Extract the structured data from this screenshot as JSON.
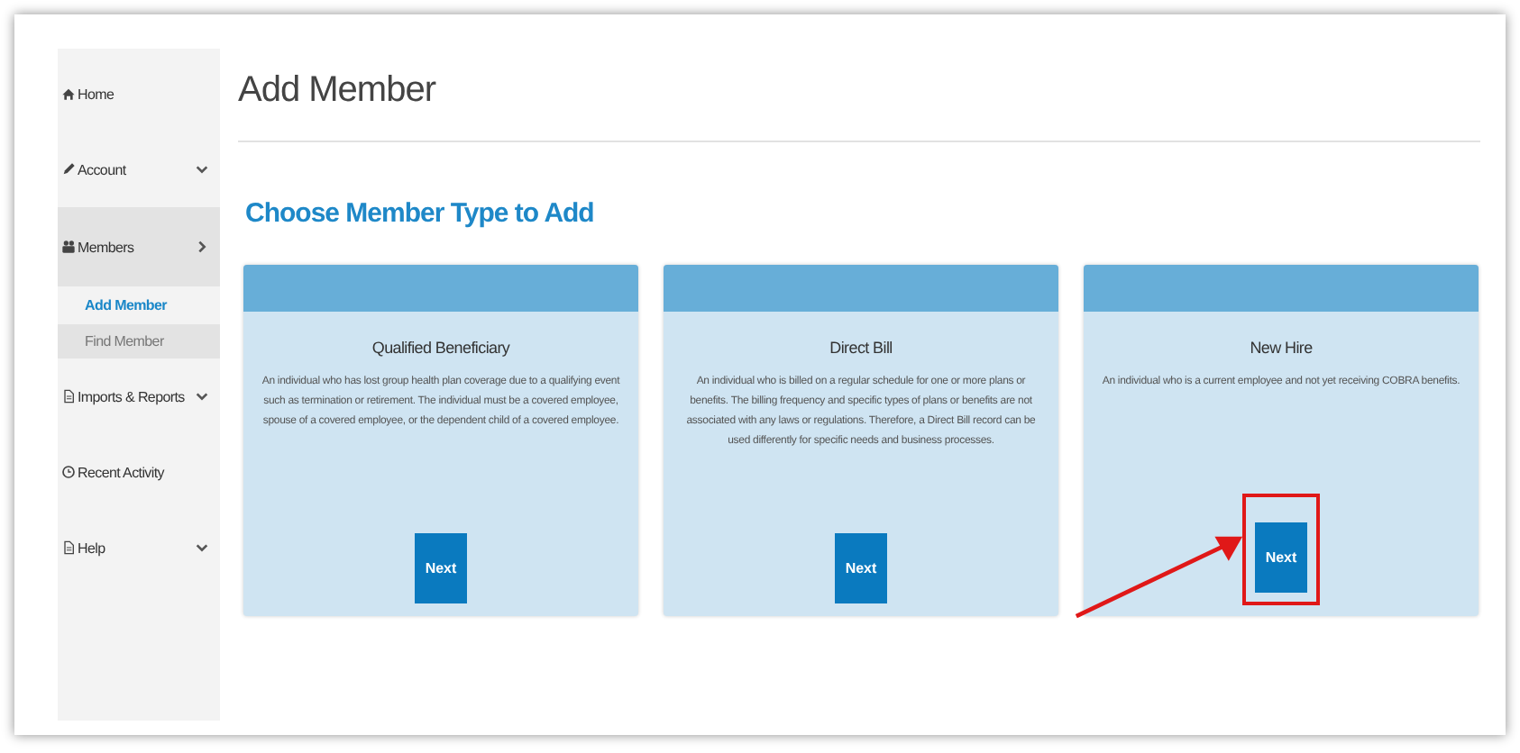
{
  "sidebar": {
    "items": [
      {
        "label": "Home",
        "selected": false
      },
      {
        "label": "Account",
        "selected": false
      },
      {
        "label": "Members",
        "selected": true,
        "children": [
          {
            "label": "Add Member",
            "selected": true
          },
          {
            "label": "Find Member",
            "selected": false
          }
        ]
      },
      {
        "label": "Imports & Reports",
        "selected": false
      },
      {
        "label": "Recent Activity",
        "selected": false
      },
      {
        "label": "Help",
        "selected": false
      }
    ]
  },
  "page_title": "Add Member",
  "section_title": "Choose Member Type to Add",
  "cards": [
    {
      "title": "Qualified Beneficiary",
      "description": "An individual who has lost group health plan coverage due to a qualifying event such as termination or retirement. The individual must be a covered employee, spouse of a covered employee, or the dependent child of a covered employee.",
      "button": "Next",
      "highlighted": false
    },
    {
      "title": "Direct Bill",
      "description": "An individual who is billed on a regular schedule for one or more plans or benefits. The billing frequency and specific types of plans or benefits are not associated with any laws or regulations. Therefore, a Direct Bill record can be used differently for specific needs and business processes.",
      "button": "Next",
      "highlighted": false
    },
    {
      "title": "New Hire",
      "description": "An individual who is a current employee and not yet receiving COBRA benefits.",
      "button": "Next",
      "highlighted": true
    }
  ]
}
